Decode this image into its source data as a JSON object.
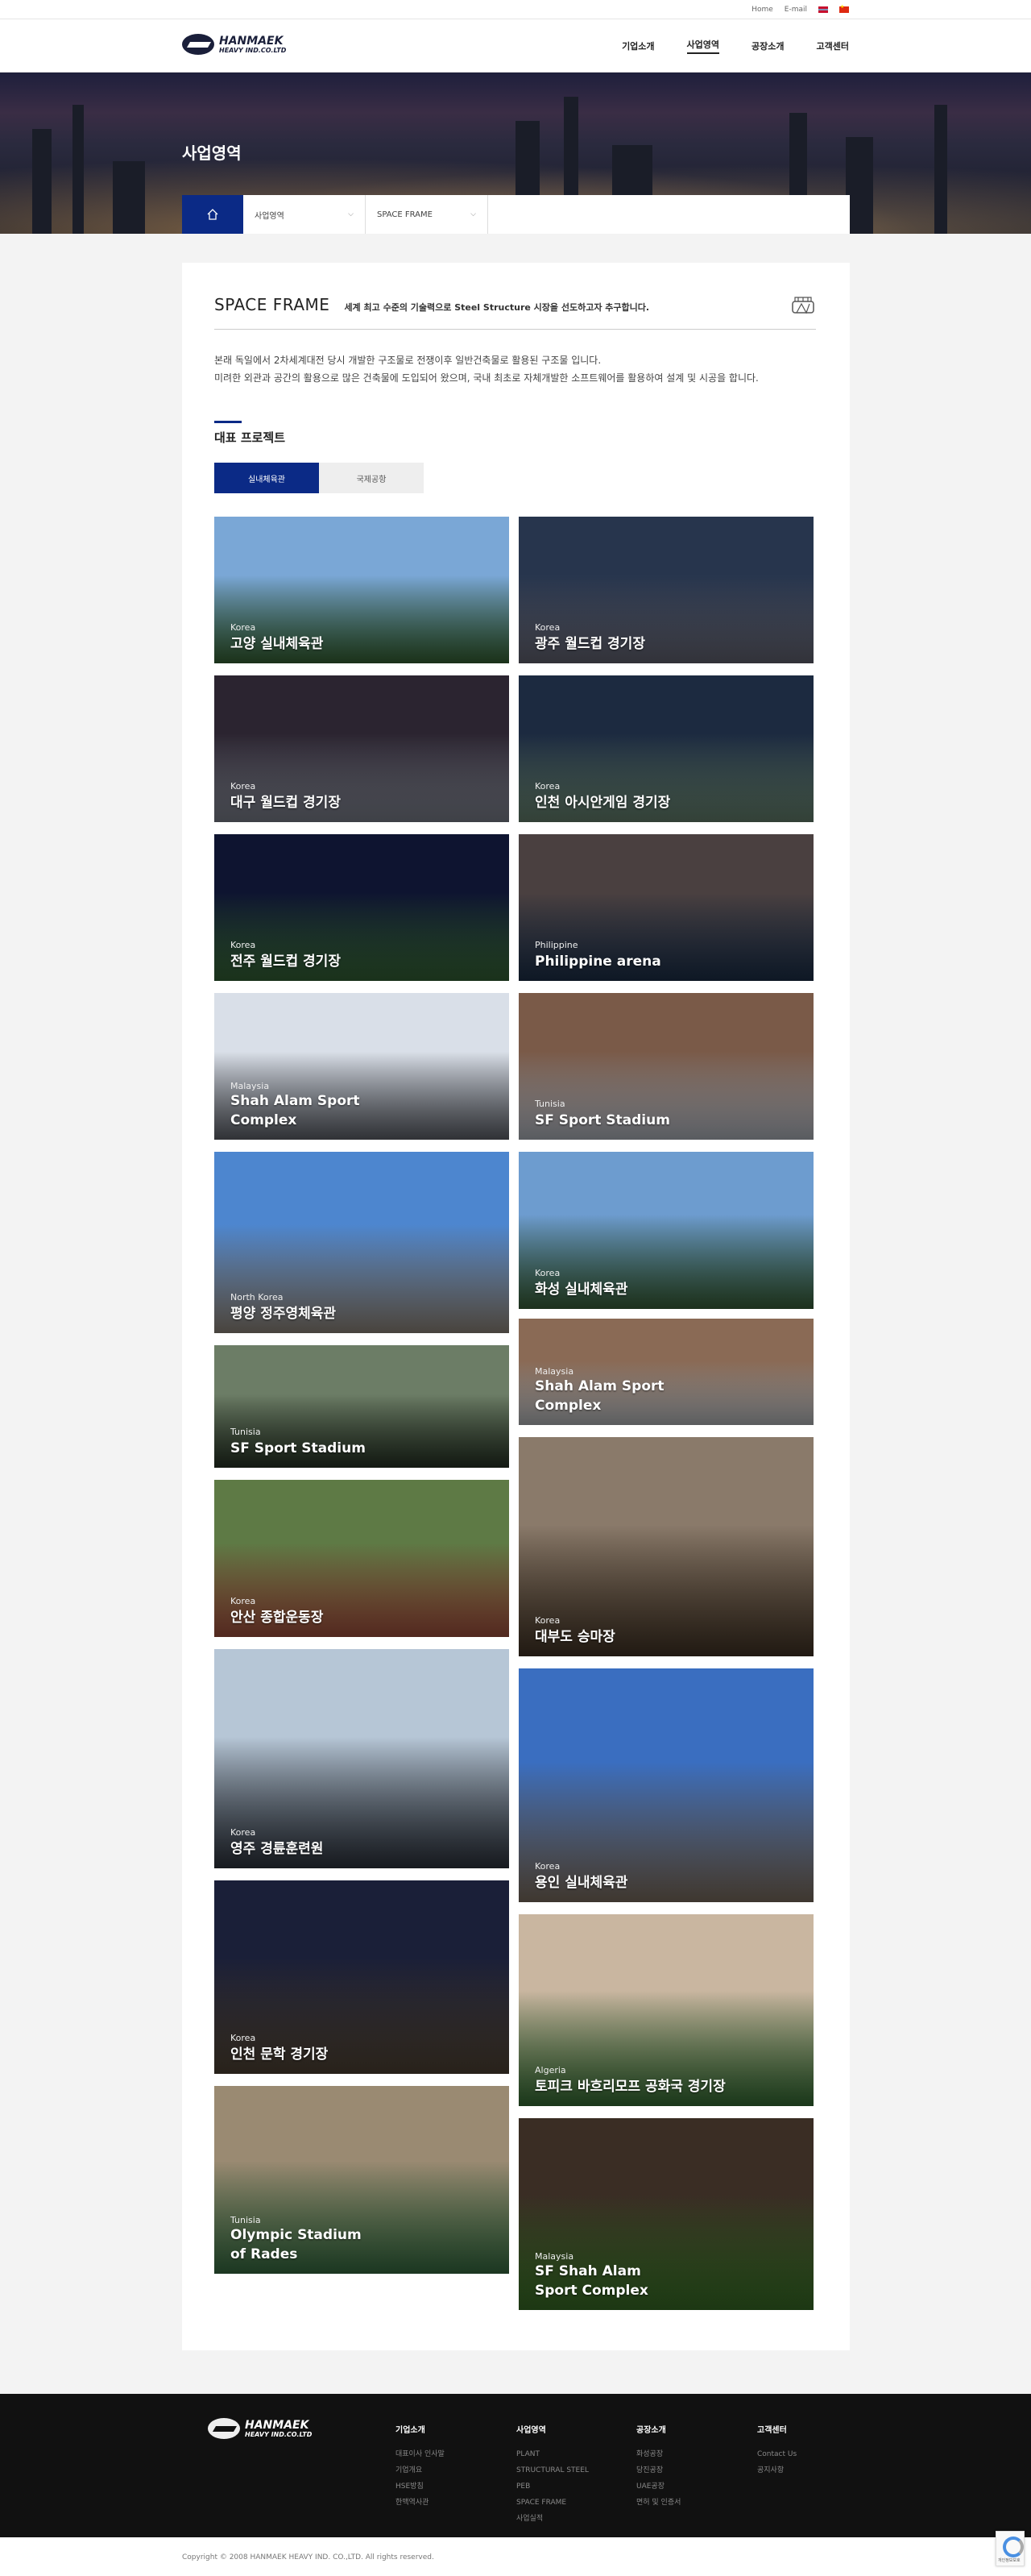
{
  "utility": {
    "home": "Home",
    "email": "E-mail"
  },
  "brand": {
    "line1": "HANMAEK",
    "line2": "HEAVY IND.CO.LTD"
  },
  "nav": [
    "기업소개",
    "사업영역",
    "공장소개",
    "고객센터"
  ],
  "nav_active": 1,
  "hero_title": "사업영역",
  "location": {
    "level1": "사업영역",
    "level2": "SPACE FRAME"
  },
  "section": {
    "title": "SPACE FRAME",
    "subtitle": "세계 최고 수준의 기술력으로 Steel Structure 시장을 선도하고자 추구합니다.",
    "desc_line1": "본래 독일에서 2차세계대전 당시 개발한 구조물로 전쟁이후 일반건축물로 활용된 구조물 입니다.",
    "desc_line2": "미려한 외관과 공간의 활용으로 많은 건축물에 도입되어 왔으며, 국내 최초로 자체개발한 소프트웨어를 활용하여 설계 및 시공을 합니다."
  },
  "projects_title": "대표 프로젝트",
  "tabs": [
    "실내체육관",
    "국제공항"
  ],
  "projects": [
    {
      "country": "Korea",
      "name": "고양 실내체육관"
    },
    {
      "country": "Korea",
      "name": "광주 월드컵 경기장"
    },
    {
      "country": "Korea",
      "name": "대구 월드컵 경기장"
    },
    {
      "country": "Korea",
      "name": "인천 아시안게임 경기장"
    },
    {
      "country": "Korea",
      "name": "전주 월드컵 경기장"
    },
    {
      "country": "Philippine",
      "name": "Philippine arena"
    },
    {
      "country": "Malaysia",
      "name": "Shah Alam Sport Complex"
    },
    {
      "country": "Tunisia",
      "name": "SF Sport Stadium"
    },
    {
      "country": "North Korea",
      "name": "평양 정주영체육관"
    },
    {
      "country": "Korea",
      "name": "화성 실내체육관"
    },
    {
      "country": "Tunisia",
      "name": "SF Sport Stadium"
    },
    {
      "country": "Malaysia",
      "name": "Shah Alam Sport Complex"
    },
    {
      "country": "Korea",
      "name": "안산 종합운동장"
    },
    {
      "country": "Korea",
      "name": "대부도 승마장"
    },
    {
      "country": "Korea",
      "name": "영주 경륜훈련원"
    },
    {
      "country": "Korea",
      "name": "용인 실내체육관"
    },
    {
      "country": "Korea",
      "name": "인천 문학 경기장"
    },
    {
      "country": "Algeria",
      "name": "토피크 바흐리모프 공화국 경기장"
    },
    {
      "country": "Tunisia",
      "name": "Olympic Stadium of Rades"
    },
    {
      "country": "Malaysia",
      "name": "SF Shah Alam Sport Complex"
    }
  ],
  "footer": {
    "cols": [
      {
        "title": "기업소개",
        "items": [
          "대표이사 인사말",
          "기업개요",
          "HSE방침",
          "한맥역사관"
        ]
      },
      {
        "title": "사업영역",
        "items": [
          "PLANT",
          "STRUCTURAL STEEL",
          "PEB",
          "SPACE FRAME",
          "사업실적"
        ]
      },
      {
        "title": "공장소개",
        "items": [
          "화성공장",
          "당진공장",
          "UAE공장",
          "면허 및 인증서"
        ]
      },
      {
        "title": "고객센터",
        "items": [
          "Contact Us",
          "공지사항"
        ]
      }
    ],
    "copyright": "Copyright © 2008 HANMAEK HEAVY IND. CO.,LTD. All rights reserved."
  },
  "recaptcha_label": "개인정보보호"
}
